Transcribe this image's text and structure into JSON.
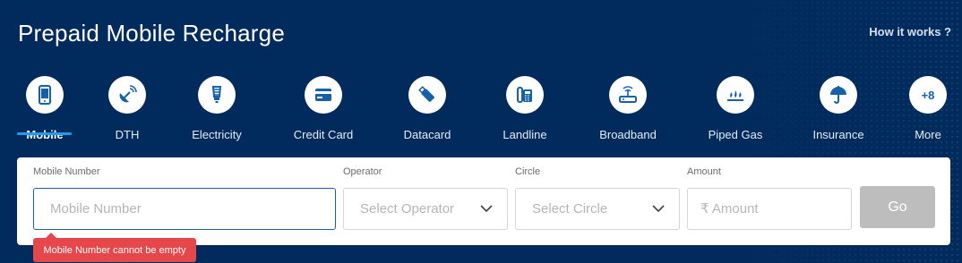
{
  "header": {
    "title": "Prepaid Mobile Recharge",
    "how_it_works": "How it works ?"
  },
  "categories": [
    {
      "label": "Mobile",
      "icon": "mobile-icon",
      "active": true
    },
    {
      "label": "DTH",
      "icon": "satellite-dish-icon"
    },
    {
      "label": "Electricity",
      "icon": "bulb-icon"
    },
    {
      "label": "Credit Card",
      "icon": "credit-card-icon"
    },
    {
      "label": "Datacard",
      "icon": "usb-datacard-icon"
    },
    {
      "label": "Landline",
      "icon": "landline-phone-icon"
    },
    {
      "label": "Broadband",
      "icon": "router-icon"
    },
    {
      "label": "Piped Gas",
      "icon": "gas-flame-icon"
    },
    {
      "label": "Insurance",
      "icon": "umbrella-icon"
    },
    {
      "label": "More",
      "icon": "more-icon",
      "badge": "+8"
    }
  ],
  "form": {
    "mobile_label": "Mobile Number",
    "mobile_placeholder": "Mobile Number",
    "mobile_value": "",
    "operator_label": "Operator",
    "operator_placeholder": "Select Operator",
    "circle_label": "Circle",
    "circle_placeholder": "Select Circle",
    "amount_label": "Amount",
    "amount_placeholder": "₹ Amount",
    "go_label": "Go",
    "error_text": "Mobile Number cannot be empty"
  },
  "colors": {
    "background": "#002b5c",
    "accent": "#1e9bf0",
    "icon": "#1561a8",
    "error": "#e5474b",
    "button_disabled": "#bdbdbd"
  }
}
